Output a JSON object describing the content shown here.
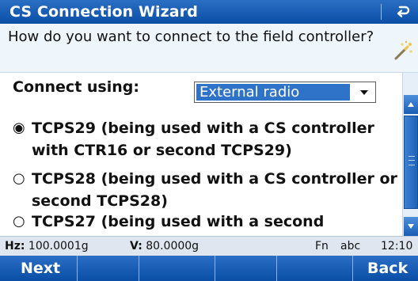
{
  "window": {
    "title": "CS Connection Wizard"
  },
  "prompt": {
    "text": "How do you want to connect to the field controller?"
  },
  "connect": {
    "label": "Connect using:",
    "selected": "External radio"
  },
  "options": [
    {
      "text": "TCPS29 (being used with a CS controller with CTR16 or second TCPS29)",
      "selected": true,
      "mark": "◉"
    },
    {
      "text": "TCPS28 (being used with a CS controller or second TCPS28)",
      "selected": false,
      "mark": "○"
    },
    {
      "text": "TCPS27 (being used with a second",
      "selected": false,
      "mark": "○"
    }
  ],
  "status": {
    "hz_label": "Hz:",
    "hz_value": "100.0001g",
    "v_label": "V:",
    "v_value": "80.0000g",
    "fn": "Fn",
    "input_mode": "abc",
    "time": "12:10"
  },
  "softkeys": [
    "Next",
    "",
    "",
    "",
    "",
    "Back"
  ],
  "colors": {
    "accent": "#0a4ea6",
    "selection": "#2f73c9",
    "prompt_bg": "#eef5fb"
  },
  "icons": {
    "title_back": "back-arrow-icon",
    "wizard": "magic-wand-icon",
    "dropdown": "triangle-down-icon"
  }
}
